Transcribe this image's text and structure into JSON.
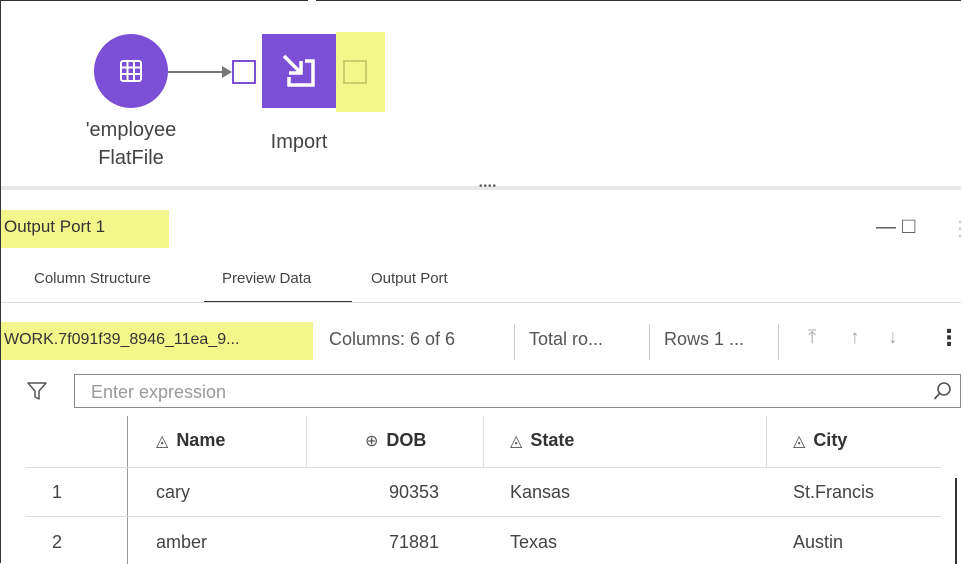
{
  "flow": {
    "source_label_line1": "'employee",
    "source_label_line2": "FlatFile",
    "import_label": "Import"
  },
  "panel": {
    "title": "Output Port 1",
    "minimize_glyph": "—",
    "maximize_glyph": "□",
    "more_glyph": "⋮"
  },
  "tabs": [
    {
      "label": "Column Structure"
    },
    {
      "label": "Preview Data"
    },
    {
      "label": "Output Port"
    }
  ],
  "toolbar": {
    "dataset": "WORK.7f091f39_8946_11ea_9...",
    "columns": "Columns: 6 of 6",
    "total_rows": "Total ro...",
    "rows_range": "Rows 1 ..."
  },
  "filter": {
    "placeholder": "Enter expression"
  },
  "table": {
    "columns": [
      {
        "name": "Name",
        "icon": "char-column-icon"
      },
      {
        "name": "DOB",
        "icon": "numeric-column-icon"
      },
      {
        "name": "State",
        "icon": "char-column-icon"
      },
      {
        "name": "City",
        "icon": "char-column-icon"
      }
    ],
    "rows": [
      {
        "num": "1",
        "Name": "cary",
        "DOB": "90353",
        "State": "Kansas",
        "City": "St.Francis"
      },
      {
        "num": "2",
        "Name": "amber",
        "DOB": "71881",
        "State": "Texas",
        "City": "Austin"
      }
    ]
  },
  "colors": {
    "node_purple": "#7b4fd6",
    "highlight_yellow": "#f3f78b"
  }
}
